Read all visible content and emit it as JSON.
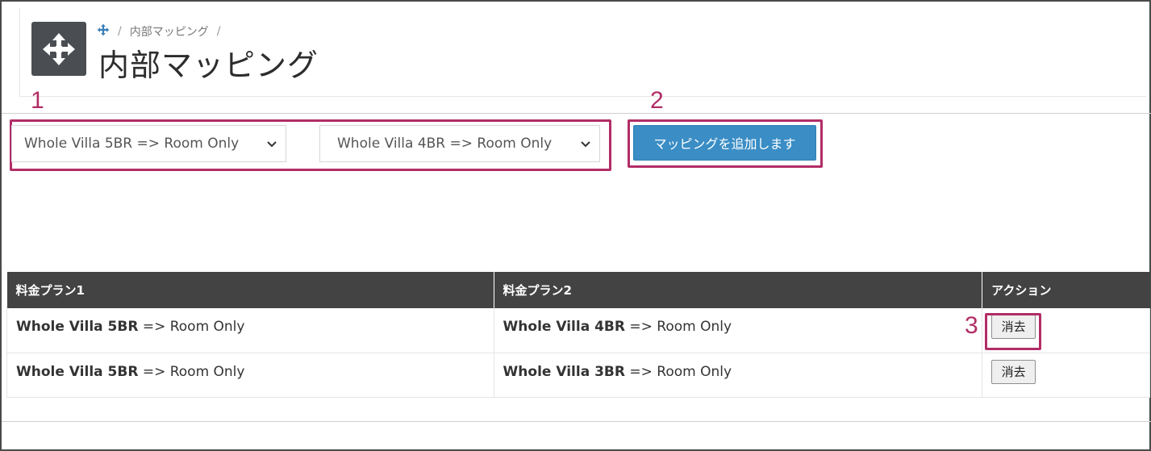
{
  "header": {
    "breadcrumb": {
      "item1": "内部マッピング",
      "sep": "/"
    },
    "title": "内部マッピング"
  },
  "annotations": {
    "one": "1",
    "two": "2",
    "three": "3",
    "color": "#b22d66"
  },
  "form": {
    "select1_value": "Whole Villa 5BR => Room Only",
    "select2_value": "Whole Villa 4BR => Room Only",
    "add_button": "マッピングを追加します"
  },
  "table": {
    "headers": [
      "料金プラン1",
      "料金プラン2",
      "アクション"
    ],
    "rows": [
      {
        "plan1_name": "Whole Villa 5BR",
        "plan1_suffix": " => Room Only",
        "plan2_name": "Whole Villa 4BR",
        "plan2_suffix": " => Room Only",
        "action": "消去"
      },
      {
        "plan1_name": "Whole Villa 5BR",
        "plan1_suffix": " => Room Only",
        "plan2_name": "Whole Villa 3BR",
        "plan2_suffix": " => Room Only",
        "action": "消去"
      }
    ]
  },
  "colors": {
    "accent": "#3a8dc5",
    "header_dark": "#434343",
    "icon_bg": "#4a4d52"
  },
  "icons": {
    "header": "move-arrows-icon",
    "breadcrumb": "move-arrows-icon",
    "select": "chevron-down-icon"
  }
}
